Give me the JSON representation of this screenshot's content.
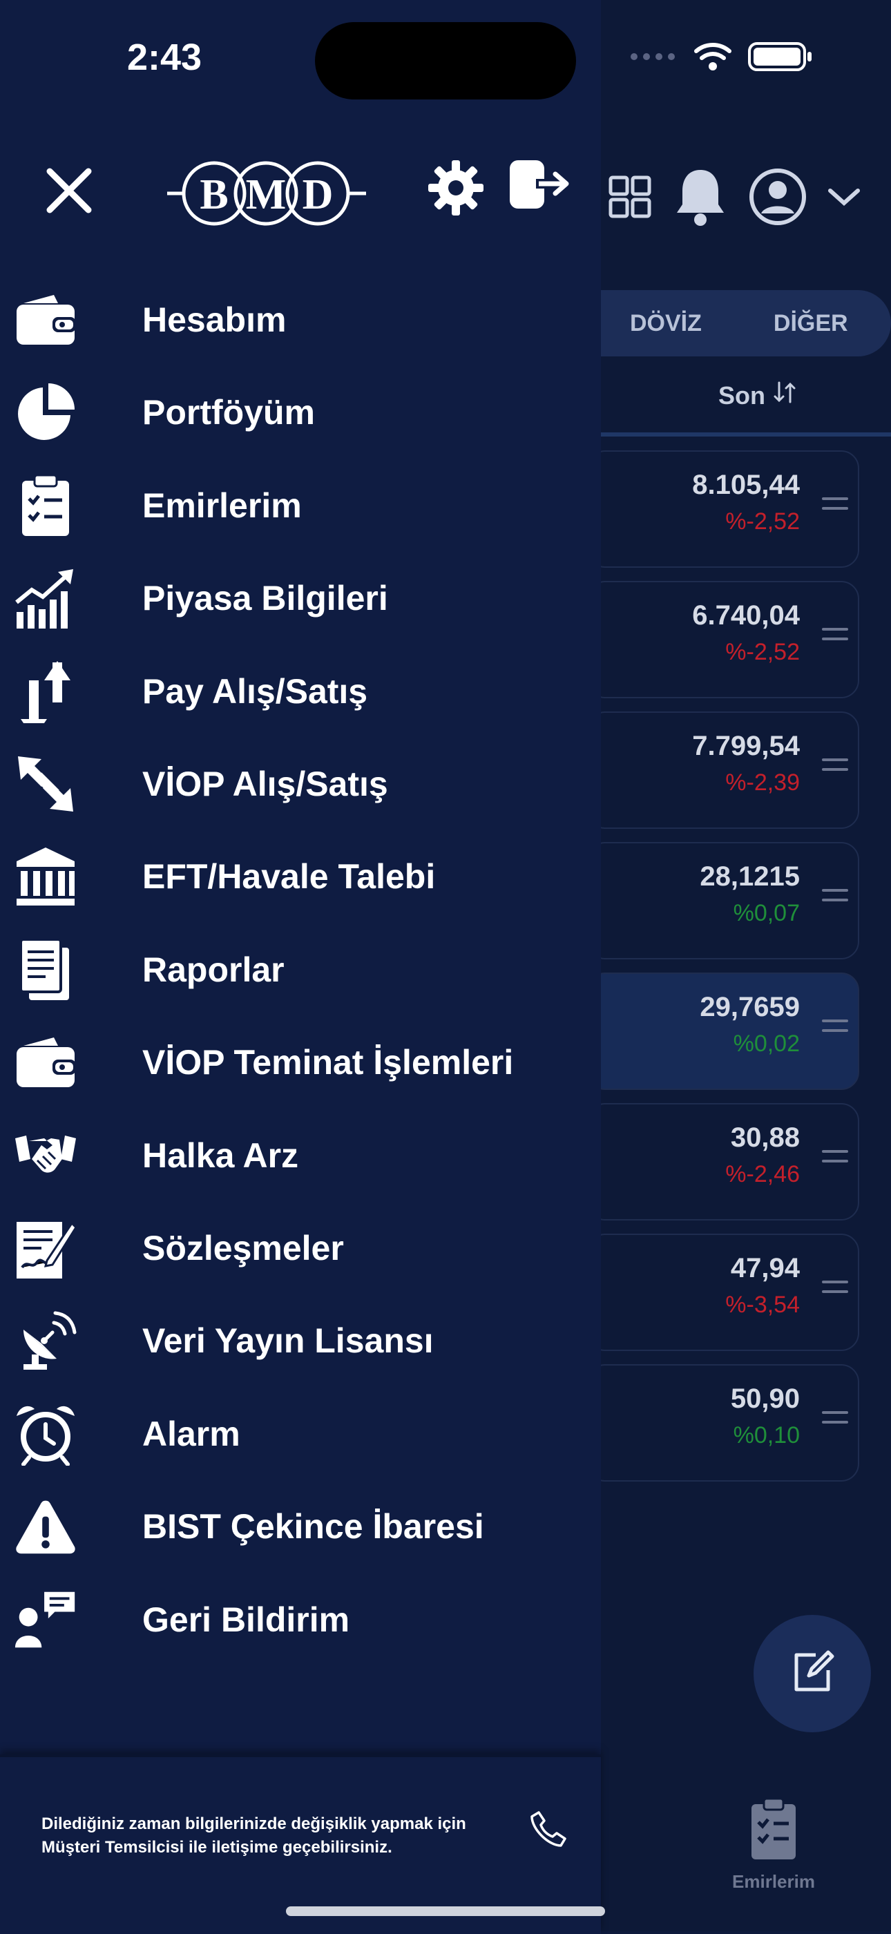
{
  "status_bar": {
    "time": "2:43"
  },
  "drawer": {
    "logo_text": "BMD",
    "menu": [
      {
        "label": "Hesabım",
        "icon": "wallet-icon"
      },
      {
        "label": "Portföyüm",
        "icon": "pie-chart-icon"
      },
      {
        "label": "Emirlerim",
        "icon": "clipboard-check-icon"
      },
      {
        "label": "Piyasa Bilgileri",
        "icon": "chart-trend-icon"
      },
      {
        "label": "Pay Alış/Satış",
        "icon": "arrows-up-down-icon"
      },
      {
        "label": "VİOP Alış/Satış",
        "icon": "arrows-diagonal-icon"
      },
      {
        "label": "EFT/Havale Talebi",
        "icon": "bank-icon"
      },
      {
        "label": "Raporlar",
        "icon": "document-icon"
      },
      {
        "label": "VİOP Teminat İşlemleri",
        "icon": "wallet-icon"
      },
      {
        "label": "Halka Arz",
        "icon": "handshake-icon"
      },
      {
        "label": "Sözleşmeler",
        "icon": "contract-sign-icon"
      },
      {
        "label": "Veri Yayın Lisansı",
        "icon": "satellite-dish-icon"
      },
      {
        "label": "Alarm",
        "icon": "alarm-clock-icon"
      },
      {
        "label": "BIST Çekince İbaresi",
        "icon": "warning-icon"
      },
      {
        "label": "Geri Bildirim",
        "icon": "feedback-icon"
      }
    ],
    "footer_text": "Dilediğiniz zaman bilgilerinizde değişiklik yapmak için Müşteri Temsilcisi ile iletişime geçebilirsiniz."
  },
  "background": {
    "tabs": [
      "DÖVİZ",
      "DİĞER"
    ],
    "column_header": "Son",
    "rows": [
      {
        "last": "8.105,44",
        "change": "%-2,52",
        "direction": "down"
      },
      {
        "last": "6.740,04",
        "change": "%-2,52",
        "direction": "down"
      },
      {
        "last": "7.799,54",
        "change": "%-2,39",
        "direction": "down"
      },
      {
        "last": "28,1215",
        "change": "%0,07",
        "direction": "up"
      },
      {
        "last": "29,7659",
        "change": "%0,02",
        "direction": "up"
      },
      {
        "last": "30,88",
        "change": "%-2,46",
        "direction": "down"
      },
      {
        "last": "47,94",
        "change": "%-3,54",
        "direction": "down"
      },
      {
        "last": "50,90",
        "change": "%0,10",
        "direction": "up"
      }
    ],
    "bottom_tab_label": "Emirlerim",
    "colors": {
      "down": "#c4202b",
      "up": "#1f8f3a",
      "accent": "#1b2d5a"
    }
  }
}
